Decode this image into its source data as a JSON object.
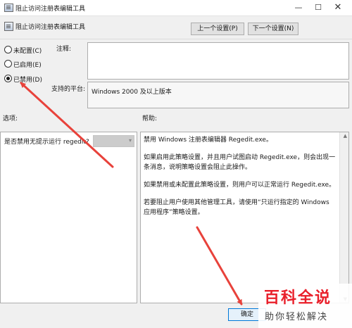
{
  "window": {
    "title": "阻止访问注册表编辑工具",
    "minimize_glyph": "—",
    "maximize_glyph": "☐",
    "close_glyph": "✕"
  },
  "header": {
    "title": "阻止访问注册表编辑工具",
    "prev_label": "上一个设置(P)",
    "next_label": "下一个设置(N)"
  },
  "policy_state": {
    "options": [
      {
        "label": "未配置(C)",
        "selected": false
      },
      {
        "label": "已启用(E)",
        "selected": false
      },
      {
        "label": "已禁用(D)",
        "selected": true
      }
    ]
  },
  "comment": {
    "label": "注释:",
    "value": ""
  },
  "platform": {
    "label": "支持的平台:",
    "value": "Windows 2000 及以上版本"
  },
  "options_panel": {
    "label": "选项:",
    "option_label": "是否禁用无提示运行 regedit?",
    "dropdown_value": ""
  },
  "help_panel": {
    "label": "帮助:",
    "paragraphs": [
      "禁用 Windows 注册表编辑器 Regedit.exe。",
      "如果启用此策略设置，并且用户试图启动 Regedit.exe，则会出现一条消息，说明策略设置会阻止此操作。",
      "如果禁用或未配置此策略设置，则用户可以正常运行 Regedit.exe。",
      "若要阻止用户使用其他管理工具，请使用“只运行指定的 Windows 应用程序”策略设置。"
    ]
  },
  "footer": {
    "ok_label": "确定"
  },
  "watermark": {
    "main": "百科全说",
    "sub": "助你轻松解决"
  },
  "colors": {
    "arrow": "#e8423b",
    "watermark_red": "#e9202b",
    "ok_border": "#0078d7"
  },
  "icons": {
    "app": "policy-window-icon",
    "dropdown": "chevron-down-icon",
    "scroll_up": "scroll-up-arrow-icon",
    "scroll_down": "scroll-down-arrow-icon"
  }
}
